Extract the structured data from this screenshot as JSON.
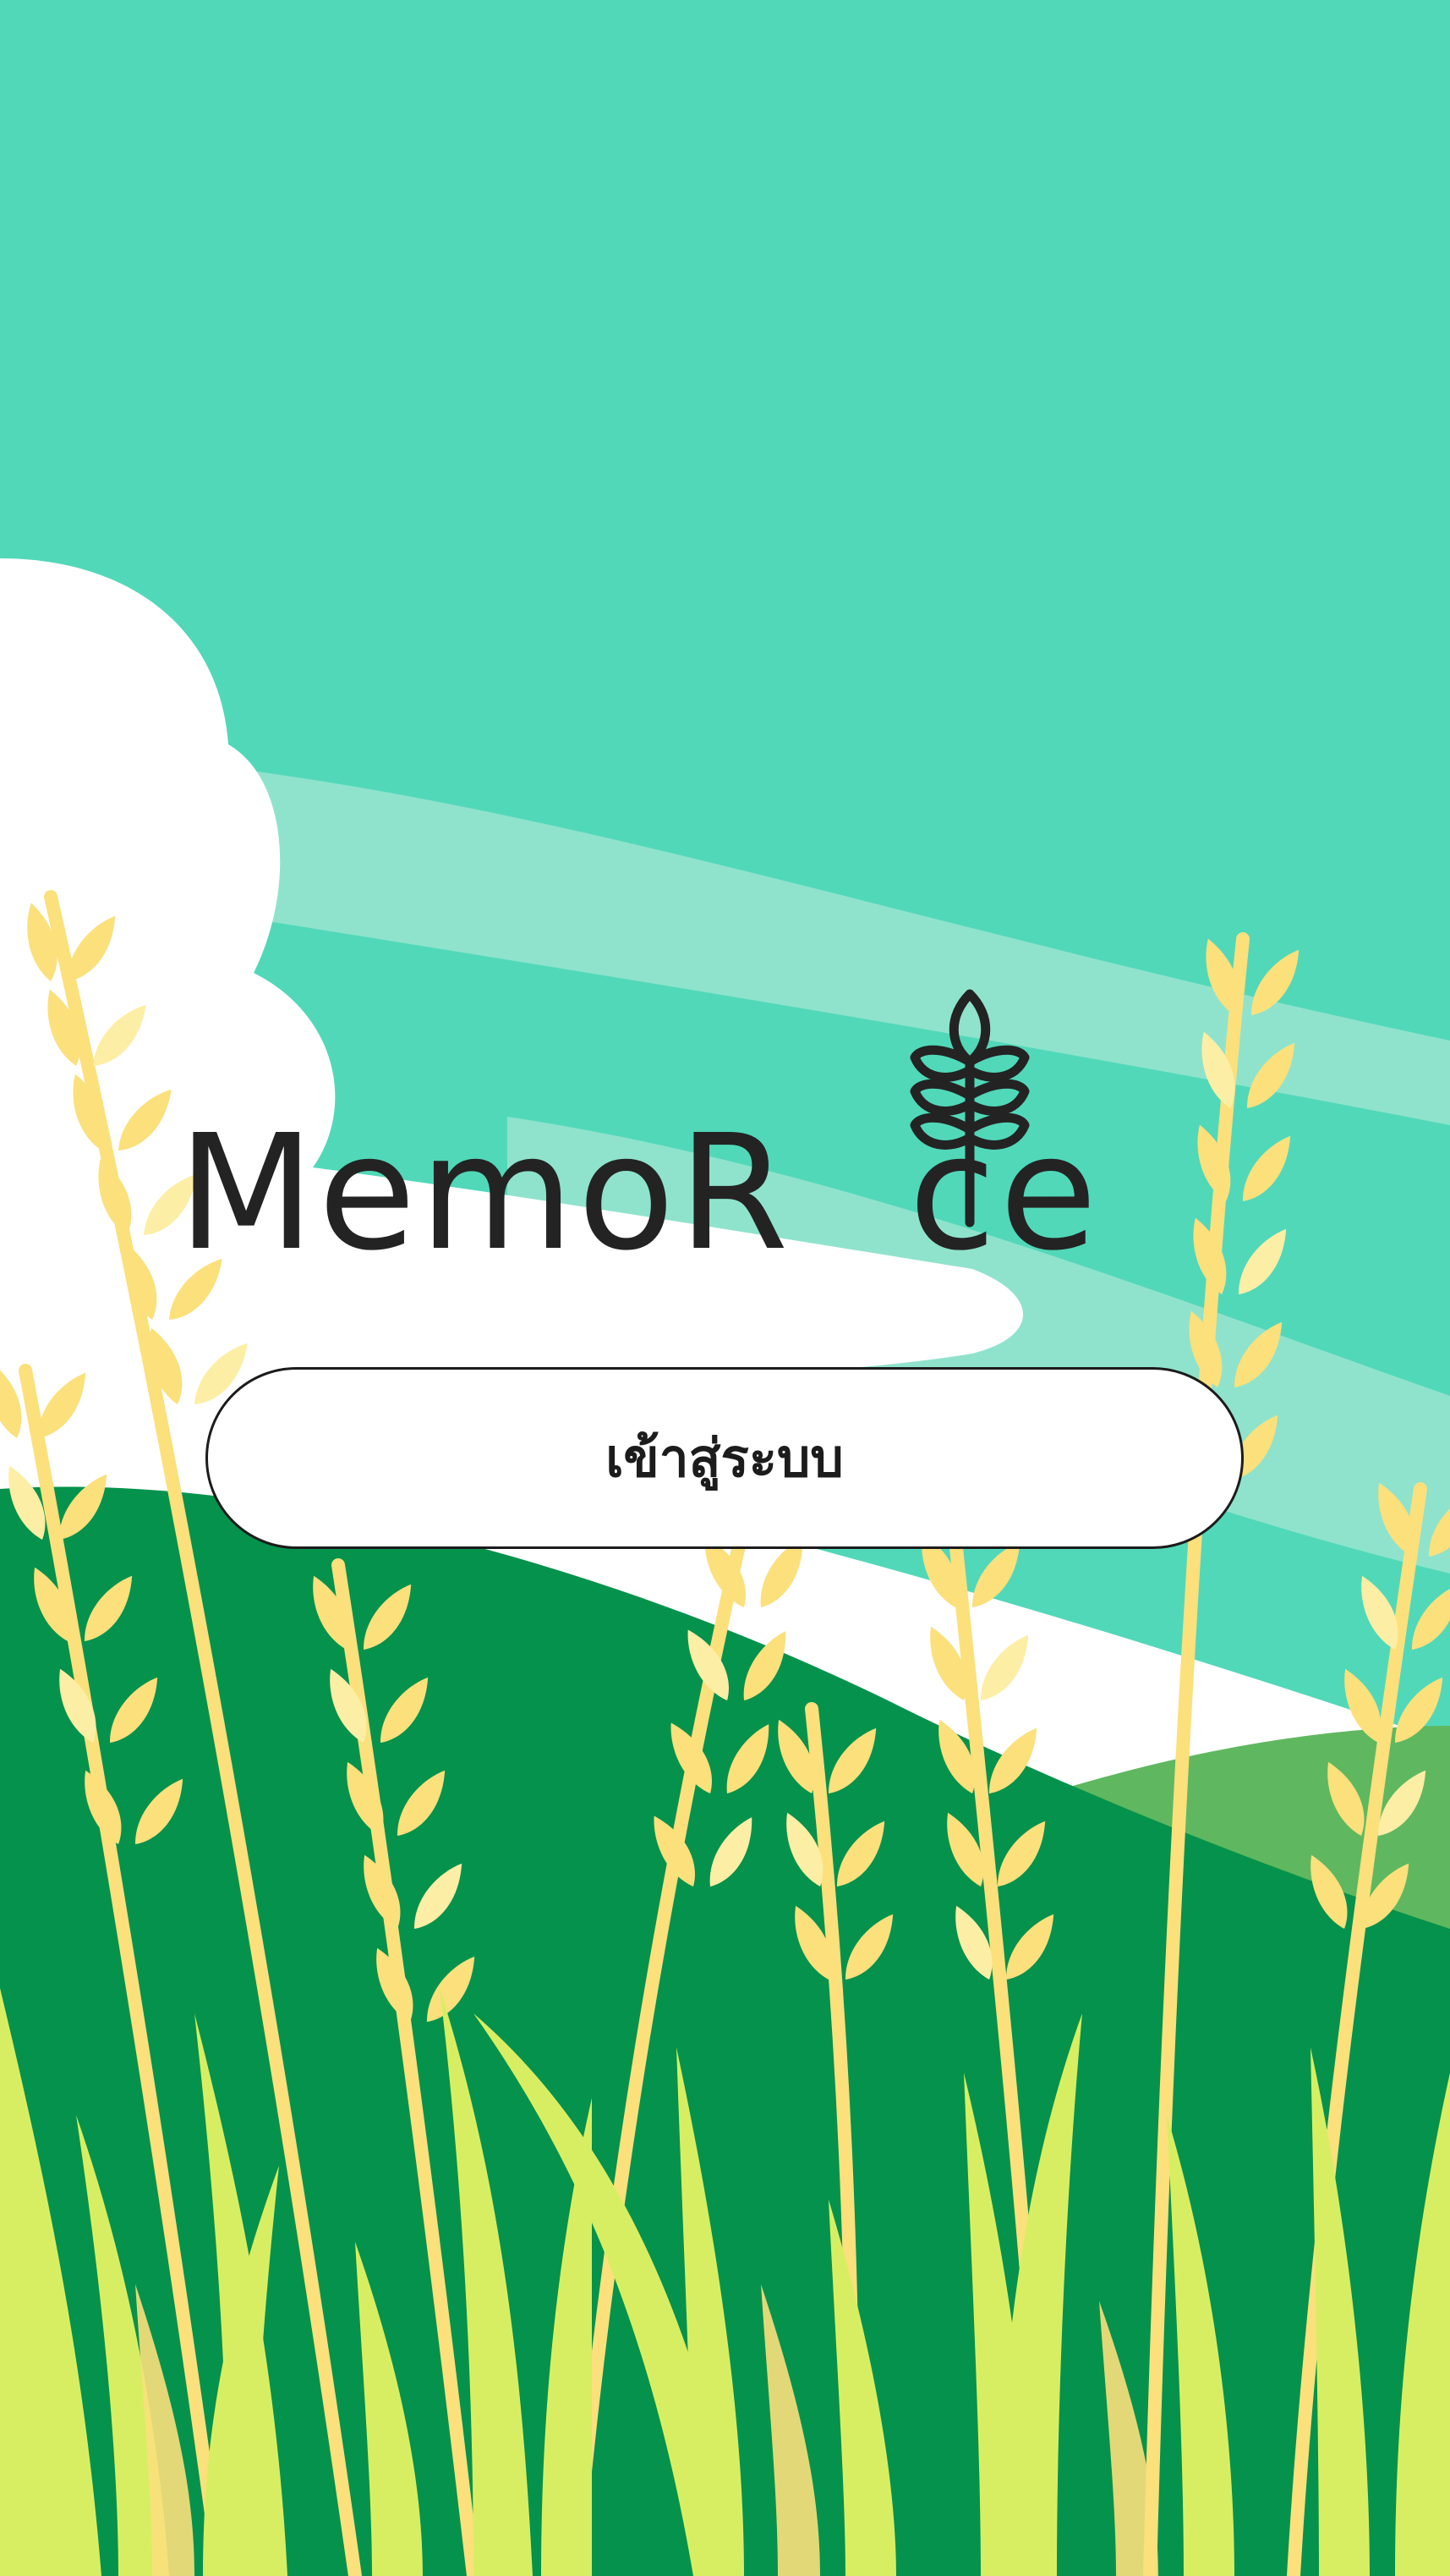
{
  "app": {
    "name_part1": "MemoR",
    "name_part2": "ce",
    "logo_icon": "rice-stalk-icon"
  },
  "login": {
    "label": "เข้าสู่ระบบ"
  },
  "colors": {
    "sky": "#51d8b9",
    "cloud": "#ffffff",
    "hill_dark": "#05924c",
    "hill_light": "#5fb85f",
    "rice_gold": "#fbe07c",
    "grass": "#d8ee62",
    "text": "#232323"
  }
}
